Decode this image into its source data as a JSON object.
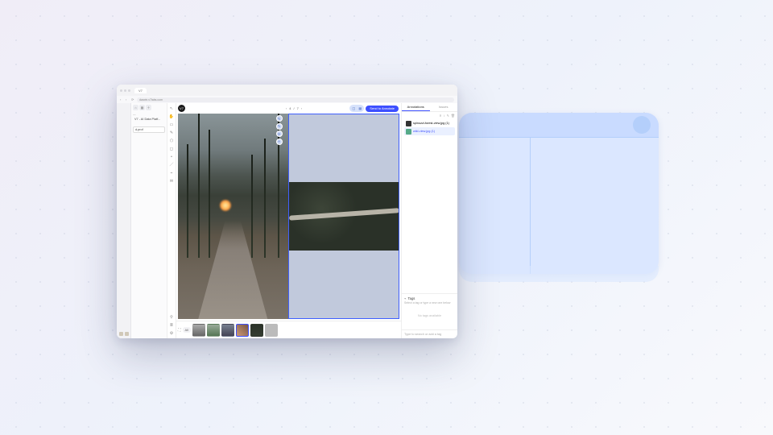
{
  "browser": {
    "tab_title": "V7",
    "url": "darwin.v7labs.com"
  },
  "sidebar": {
    "top_icons": [
      "home-icon",
      "projects-icon",
      "plus-icon"
    ],
    "section_label": "—",
    "dataset_item": "V7 - AI Data Platf...",
    "edit_item": "d.prof"
  },
  "rail_icons": [
    "cursor-icon",
    "hand-icon",
    "select-icon",
    "brush-icon",
    "polygon-icon",
    "box-icon",
    "point-icon",
    "line-icon",
    "tag-icon",
    "comment-icon",
    "zoom-icon",
    "layers-icon",
    "settings-icon"
  ],
  "avatar_initials": "V7",
  "pager": {
    "prev": "‹",
    "pos": "4",
    "sep": "/",
    "total": "7",
    "next": "›"
  },
  "toggle_icons": [
    "single-view-icon",
    "grid-view-icon"
  ],
  "send_button": "Send to Annotate",
  "filmstrip": {
    "expand": "⛶",
    "all": "All",
    "thumbs": [
      "a",
      "b",
      "c",
      "d",
      "e",
      "f"
    ],
    "selected_index": 3
  },
  "right": {
    "tabs": [
      "Annotations",
      "Issues"
    ],
    "active_tab": 0,
    "tool_icons": [
      "filter-icon",
      "sort-icon",
      "edit-icon",
      "trash-icon"
    ],
    "files": [
      {
        "name": "spinozzi-forest-view.jpg (1)",
        "selected": false
      },
      {
        "name": "wild-view.jpg (1)",
        "selected": true
      }
    ],
    "tags_label": "Tags",
    "tags_hint": "Select a tag or type a new one below",
    "no_tags": "No tags available",
    "search_placeholder": "Type to search or add a tag"
  }
}
